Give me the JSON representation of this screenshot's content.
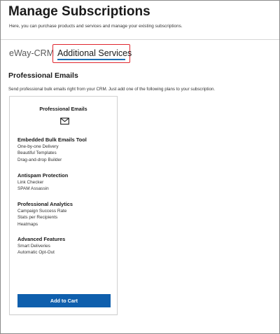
{
  "header": {
    "title": "Manage Subscriptions",
    "subtitle": "Here, you can purchase products and services and manage your existing subscriptions."
  },
  "tabs": [
    {
      "label": "eWay-CRM",
      "active": false
    },
    {
      "label": "Additional Services",
      "active": true
    }
  ],
  "colors": {
    "accent": "#1a6fb5",
    "button": "#0f5fad",
    "highlight": "#e0262e"
  },
  "section": {
    "heading": "Professional Emails",
    "description": "Send professional bulk emails right from your CRM. Just add one of the following plans to your subscription."
  },
  "card": {
    "title": "Professional Emails",
    "icon": "mail-icon",
    "groups": [
      {
        "heading": "Embedded Bulk Emails Tool",
        "items": [
          "One-by-one Delivery",
          "Beautiful Templates",
          "Drag-and-drop Builder"
        ]
      },
      {
        "heading": "Antispam Protection",
        "items": [
          "Link Checker",
          "SPAM Assassin"
        ]
      },
      {
        "heading": "Professional Analytics",
        "items": [
          "Campaign Success Rate",
          "Stats per Recipients",
          "Heatmaps"
        ]
      },
      {
        "heading": "Advanced Features",
        "items": [
          "Smart Deliveries",
          "Automatic Opt-Out"
        ]
      }
    ],
    "button_label": "Add to Cart"
  }
}
